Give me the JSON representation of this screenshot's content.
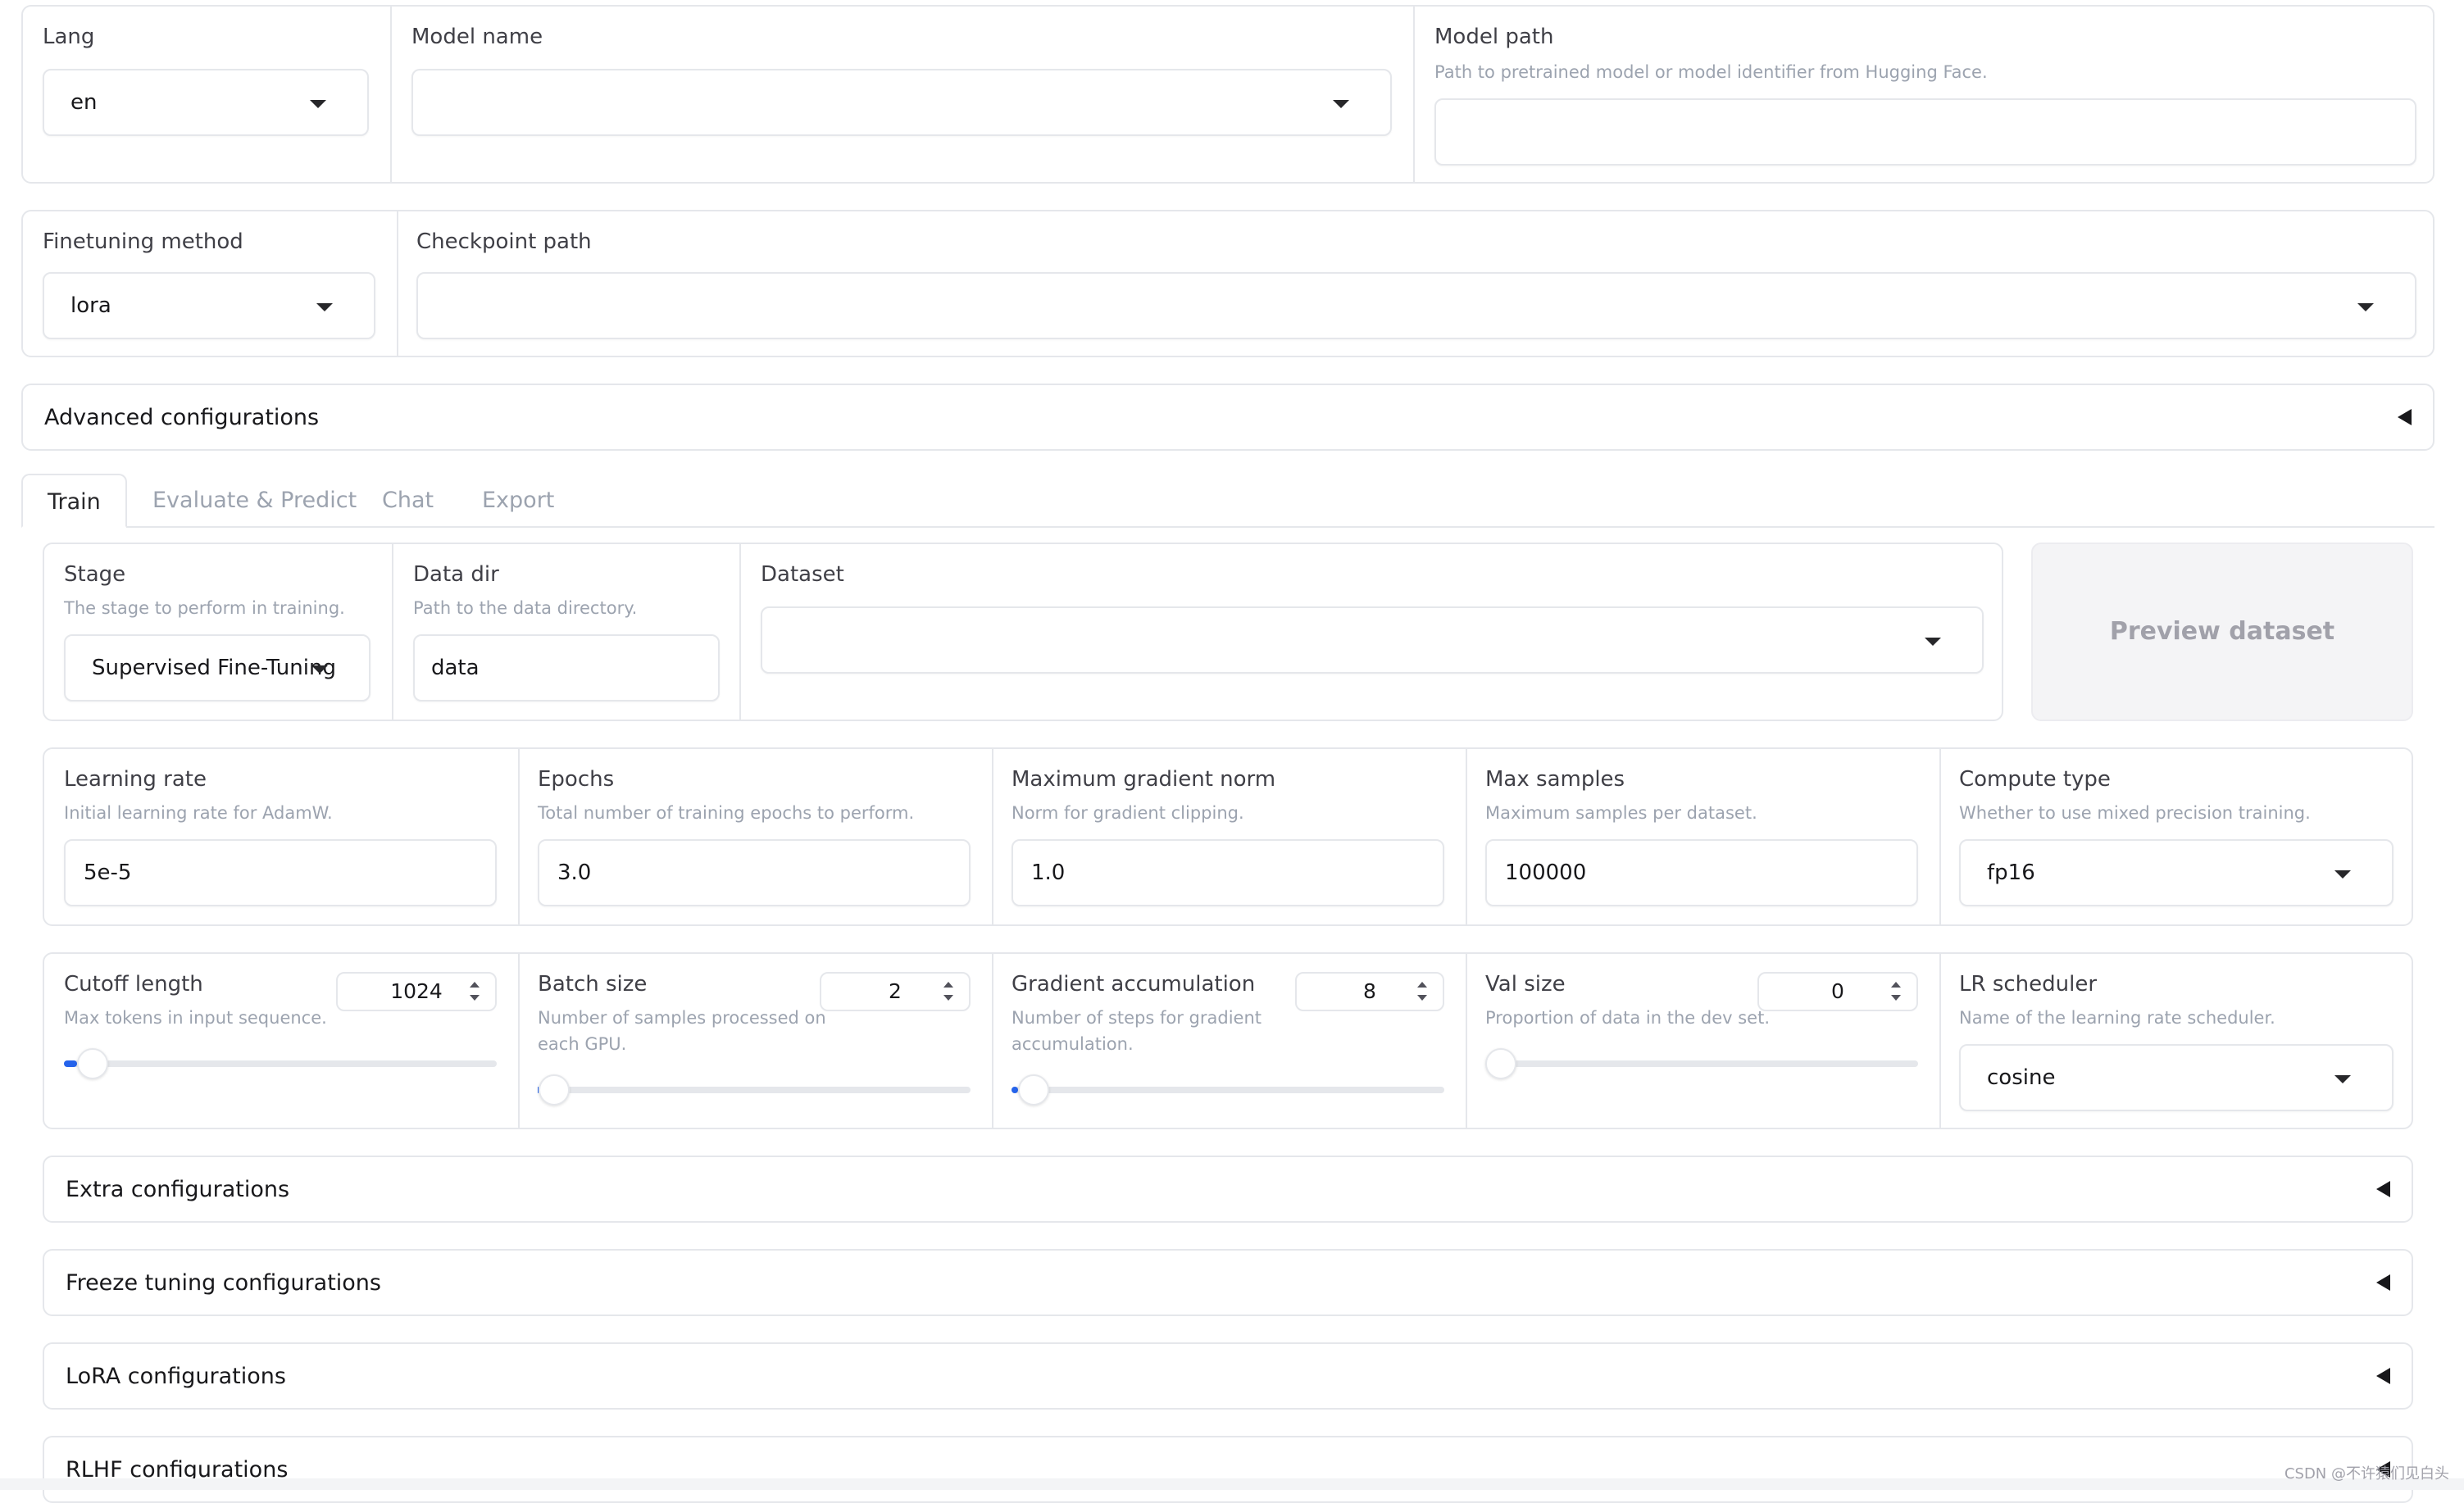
{
  "top": {
    "lang": {
      "label": "Lang",
      "value": "en"
    },
    "model_name": {
      "label": "Model name",
      "value": ""
    },
    "model_path": {
      "label": "Model path",
      "hint": "Path to pretrained model or model identifier from Hugging Face.",
      "value": ""
    }
  },
  "second": {
    "finetuning_method": {
      "label": "Finetuning method",
      "value": "lora"
    },
    "checkpoint_path": {
      "label": "Checkpoint path",
      "value": ""
    }
  },
  "advanced": {
    "label": "Advanced configurations"
  },
  "tabs": [
    {
      "label": "Train",
      "active": true
    },
    {
      "label": "Evaluate & Predict",
      "active": false
    },
    {
      "label": "Chat",
      "active": false
    },
    {
      "label": "Export",
      "active": false
    }
  ],
  "train": {
    "stage": {
      "label": "Stage",
      "hint": "The stage to perform in training.",
      "value": "Supervised Fine-Tuning"
    },
    "data_dir": {
      "label": "Data dir",
      "hint": "Path to the data directory.",
      "value": "data"
    },
    "dataset": {
      "label": "Dataset",
      "value": ""
    },
    "preview_button": "Preview dataset",
    "learning_rate": {
      "label": "Learning rate",
      "hint": "Initial learning rate for AdamW.",
      "value": "5e-5"
    },
    "epochs": {
      "label": "Epochs",
      "hint": "Total number of training epochs to perform.",
      "value": "3.0"
    },
    "max_grad_norm": {
      "label": "Maximum gradient norm",
      "hint": "Norm for gradient clipping.",
      "value": "1.0"
    },
    "max_samples": {
      "label": "Max samples",
      "hint": "Maximum samples per dataset.",
      "value": "100000"
    },
    "compute_type": {
      "label": "Compute type",
      "hint": "Whether to use mixed precision training.",
      "value": "fp16"
    },
    "cutoff_length": {
      "label": "Cutoff length",
      "hint": "Max tokens in input sequence.",
      "value": "1024",
      "slider_fraction": 0.03
    },
    "batch_size": {
      "label": "Batch size",
      "hint_1": "Number of samples processed on",
      "hint_2": "each GPU.",
      "value": "2",
      "slider_fraction": 0.002
    },
    "grad_accum": {
      "label": "Gradient accumulation",
      "hint_1": "Number of steps for gradient",
      "hint_2": "accumulation.",
      "value": "8",
      "slider_fraction": 0.015
    },
    "val_size": {
      "label": "Val size",
      "hint": "Proportion of data in the dev set.",
      "value": "0",
      "slider_fraction": 0.0
    },
    "lr_scheduler": {
      "label": "LR scheduler",
      "hint": "Name of the learning rate scheduler.",
      "value": "cosine"
    }
  },
  "accordions": [
    "Extra configurations",
    "Freeze tuning configurations",
    "LoRA configurations",
    "RLHF configurations"
  ],
  "watermark": "CSDN @不许猿们见白头",
  "colors": {
    "accent": "#2563eb",
    "border": "#e5e7eb",
    "muted": "#9ca3af"
  }
}
